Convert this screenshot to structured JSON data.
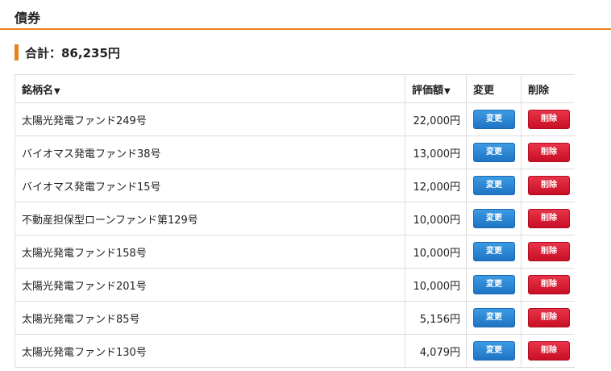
{
  "section": {
    "title": "債券"
  },
  "total": {
    "text": "合計：86,235円"
  },
  "table": {
    "headers": {
      "name": "銘柄名",
      "name_sort": "▼",
      "amount": "評価額",
      "amount_sort": "▼",
      "edit": "変更",
      "delete": "削除"
    },
    "rows": [
      {
        "name": "太陽光発電ファンド249号",
        "amount": "22,000円",
        "edit": "変更",
        "delete": "削除"
      },
      {
        "name": "バイオマス発電ファンド38号",
        "amount": "13,000円",
        "edit": "変更",
        "delete": "削除"
      },
      {
        "name": "バイオマス発電ファンド15号",
        "amount": "12,000円",
        "edit": "変更",
        "delete": "削除"
      },
      {
        "name": "不動産担保型ローンファンド第129号",
        "amount": "10,000円",
        "edit": "変更",
        "delete": "削除"
      },
      {
        "name": "太陽光発電ファンド158号",
        "amount": "10,000円",
        "edit": "変更",
        "delete": "削除"
      },
      {
        "name": "太陽光発電ファンド201号",
        "amount": "10,000円",
        "edit": "変更",
        "delete": "削除"
      },
      {
        "name": "太陽光発電ファンド85号",
        "amount": "5,156円",
        "edit": "変更",
        "delete": "削除"
      },
      {
        "name": "太陽光発電ファンド130号",
        "amount": "4,079円",
        "edit": "変更",
        "delete": "削除"
      }
    ]
  },
  "colors": {
    "accent": "#e8821e",
    "edit_button": "#2a86d4",
    "delete_button": "#d81b30"
  }
}
